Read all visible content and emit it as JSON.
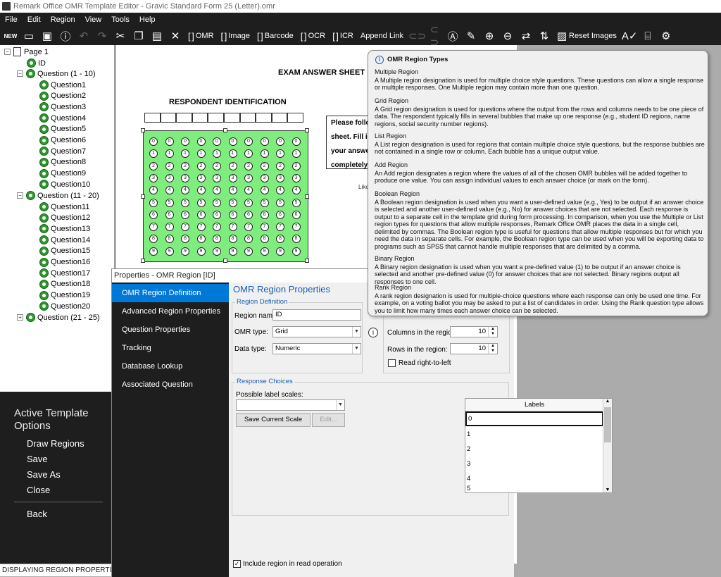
{
  "window": {
    "title": "Remark Office OMR Template Editor - Gravic Standard Form 25 (Letter).omr"
  },
  "menu": [
    "File",
    "Edit",
    "Region",
    "View",
    "Tools",
    "Help"
  ],
  "toolbar": {
    "omr": "OMR",
    "image": "Image",
    "barcode": "Barcode",
    "ocr": "OCR",
    "icr": "ICR",
    "append_link": "Append Link",
    "reset_images": "Reset Images"
  },
  "tree": {
    "page": "Page 1",
    "id": "ID",
    "group1": "Question (1 - 10)",
    "group1_items": [
      "Question1",
      "Question2",
      "Question3",
      "Question4",
      "Question5",
      "Question6",
      "Question7",
      "Question8",
      "Question9",
      "Question10"
    ],
    "group2": "Question (11 - 20)",
    "group2_items": [
      "Question11",
      "Question12",
      "Question13",
      "Question14",
      "Question15",
      "Question16",
      "Question17",
      "Question18",
      "Question19",
      "Question20"
    ],
    "group3": "Question (21 - 25)"
  },
  "left_panel": {
    "title": "Active Template Options",
    "items": [
      "Draw Regions",
      "Save",
      "Save As",
      "Close"
    ],
    "back": "Back"
  },
  "status": "DISPLAYING REGION PROPERTIES [ID]...",
  "form": {
    "exam_title": "EXAM ANSWER SHEET",
    "respondent_title": "RESPONDENT IDENTIFICATION",
    "bubble_digits": [
      "0",
      "1",
      "2",
      "3",
      "4",
      "5",
      "6",
      "7",
      "8",
      "9"
    ],
    "instructions": [
      "Please follo",
      "sheet. Fill i",
      "your answe",
      "completely"
    ],
    "likert": "Like"
  },
  "properties": {
    "title": "Properties - OMR Region [ID]",
    "nav": [
      "OMR Region Definition",
      "Advanced Region Properties",
      "Question Properties",
      "Tracking",
      "Database Lookup",
      "Associated Question"
    ],
    "heading": "OMR Region Properties",
    "region_definition_legend": "Region Definition",
    "region_name_label": "Region name:",
    "region_name_value": "ID",
    "omr_type_label": "OMR type:",
    "omr_type_value": "Grid",
    "data_type_label": "Data type:",
    "data_type_value": "Numeric",
    "columns_label": "Columns in the region:",
    "columns_value": "10",
    "rows_label": "Rows in the region:",
    "rows_value": "10",
    "read_rtl_label": "Read right-to-left",
    "response_choices_legend": "Response Choices",
    "possible_scales_label": "Possible label scales:",
    "save_scale_btn": "Save Current Scale",
    "edit_btn": "Edit...",
    "labels_header": "Labels",
    "labels": [
      "0",
      "1",
      "2",
      "3",
      "4",
      "5"
    ],
    "include_label": "Include region in read operation"
  },
  "tooltip": {
    "title": "OMR Region Types",
    "sections": [
      {
        "h": "Multiple Region",
        "b": "A Multiple region designation is used for multiple choice style questions. These questions can allow a single response or multiple responses. One Multiple region may contain more than one question."
      },
      {
        "h": "Grid Region",
        "b": "A Grid region designation is used for questions where the output from the rows and columns needs to be one piece of data. The respondent typically fills in several bubbles that make up one response (e.g., student ID regions, name regions, social security number regions)."
      },
      {
        "h": "List Region",
        "b": "A List region designation is used for regions that contain multiple choice style questions, but the response bubbles are not contained in a single row or column. Each bubble has a unique output value."
      },
      {
        "h": "Add Region",
        "b": "An Add region designates a region where the values of all of the chosen OMR bubbles will be added together to produce one value. You can assign individual values to each answer choice (or mark on the form)."
      },
      {
        "h": "Boolean Region",
        "b": "A Boolean region designation is used when you want a user-defined value (e.g., Yes) to be output if an answer choice is selected and another user-defined value (e.g., No) for answer choices that are not selected. Each response is output to a separate cell in the template grid during form processing. In comparison, when you use the Multiple or List region types for questions that allow multiple responses, Remark Office OMR places the data in a single cell, delimited by commas. The Boolean region type is useful for questions that allow multiple responses but for which you need the data in separate cells. For example, the Boolean region type can be used when you will be exporting data to programs such as SPSS that cannot handle multiple responses that are delimited by a comma."
      },
      {
        "h": "Binary Region",
        "b": "A Binary region designation is used when you want a pre-defined value (1) to be output if an answer choice is selected and another pre-defined value (0) for answer choices that are not selected. Binary regions output all responses to one cell."
      },
      {
        "h": "Rank Region",
        "b": "A rank region designation is used for multiple-choice questions where each response can only be used one time. For example, on a voting ballot you may be asked to put a list of candidates in order. Using the Rank question type allows you to limit how many times each answer choice can be selected."
      }
    ]
  }
}
